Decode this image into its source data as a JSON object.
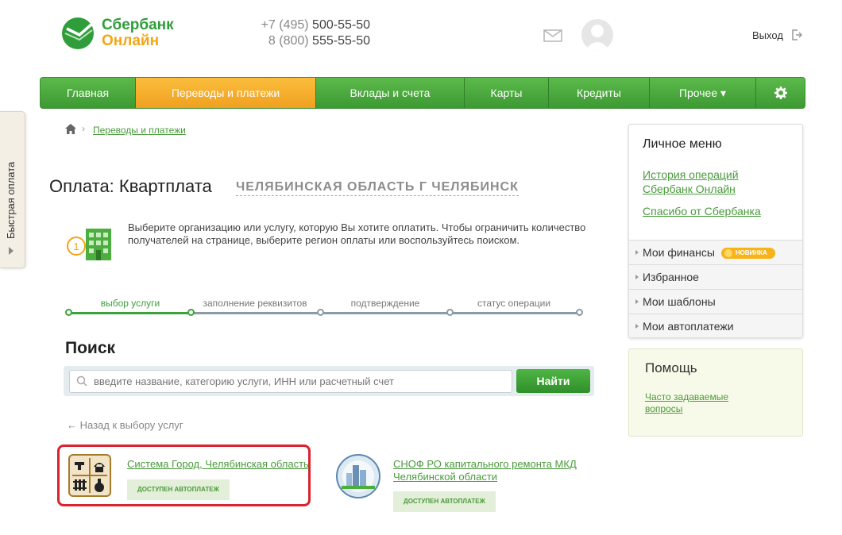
{
  "header": {
    "logo_line1": "Сбербанк",
    "logo_line2": "Онлайн",
    "phone1_prefix": "+7 (495) ",
    "phone1_number": "500-55-50",
    "phone2_prefix": "8 (800) ",
    "phone2_number": "555-55-50",
    "exit_label": "Выход"
  },
  "nav": {
    "items": [
      "Главная",
      "Переводы и платежи",
      "Вклады и счета",
      "Карты",
      "Кредиты",
      "Прочее ▾"
    ],
    "active_index": 1
  },
  "quick_pay": {
    "label": "Быстрая оплата"
  },
  "breadcrumb": {
    "link": "Переводы и платежи"
  },
  "page": {
    "title": "Оплата: Квартплата",
    "region": "ЧЕЛЯБИНСКАЯ ОБЛАСТЬ Г ЧЕЛЯБИНСК",
    "info_text": "Выберите организацию или услугу, которую Вы хотите оплатить. Чтобы ограничить количество получателей на странице, выберите регион оплаты или воспользуйтесь поиском."
  },
  "steps": [
    "выбор услуги",
    "заполнение реквизитов",
    "подтверждение",
    "статус операции"
  ],
  "search": {
    "heading": "Поиск",
    "placeholder": "введите название, категорию услуги, ИНН или расчетный счет",
    "button": "Найти"
  },
  "back_link": "← Назад к выбору услуг",
  "results": [
    {
      "title": "Система Город, Челябинская область",
      "badge": "ДОСТУПЕН АВТОПЛАТЕЖ"
    },
    {
      "title_line1": "СНОФ РО капитального ремонта МКД",
      "title_line2": "Челябинской области",
      "badge": "ДОСТУПЕН АВТОПЛАТЕЖ"
    }
  ],
  "personal_menu": {
    "title": "Личное меню",
    "link1_line1": "История операций",
    "link1_line2": "Сбербанк Онлайн",
    "link2": "Спасибо от Сбербанка",
    "items": [
      "Мои финансы",
      "Избранное",
      "Мои шаблоны",
      "Мои автоплатежи"
    ],
    "new_badge": "НОВИНКА"
  },
  "help": {
    "title": "Помощь",
    "link_line1": "Часто задаваемые",
    "link_line2": "вопросы"
  },
  "colors": {
    "brand_green": "#3d9a33",
    "active_orange": "#f0a020",
    "link_green": "#4a9a3c",
    "highlight_red": "#d9232e"
  }
}
